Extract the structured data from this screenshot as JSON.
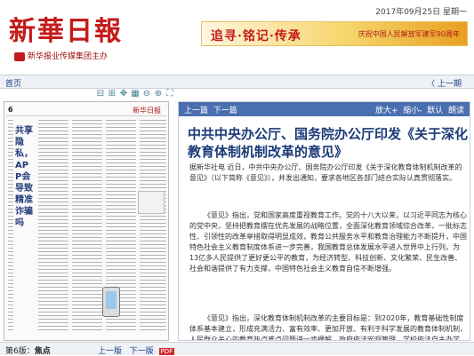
{
  "masthead": {
    "logo": "新華日報",
    "subtitle": "新华报业传媒集团主办",
    "date": "2017年09月25日",
    "weekday": "星期一"
  },
  "banner": {
    "text": "追寻·铭记·传承",
    "subtext": "庆祝中国人民解放军建军90周年"
  },
  "nav": {
    "home": "首页",
    "prev": "〈 上一期"
  },
  "toolbar": {
    "icons": [
      "shrink-icon",
      "expand-icon",
      "move-icon",
      "grid-icon",
      "zoom-out-icon",
      "zoom-in-icon",
      "fullscreen-icon"
    ]
  },
  "thumbnail": {
    "page_no": "6",
    "paper_name": "新华日报",
    "headline": "共享隐私，APP会导致精准诈骗吗"
  },
  "pagenav": {
    "page_label": "第6版：",
    "page_name": "焦点",
    "prev_page": "上一版",
    "next_page": "下一版",
    "pdf": "PDF"
  },
  "article_toolbar": {
    "prev_article": "上一篇",
    "next_article": "下一篇",
    "zoom_in": "放大+",
    "zoom_out": "缩小-",
    "reset": "默认",
    "read": "朗读"
  },
  "article": {
    "title": "中共中央办公厅、国务院办公厅印发《关于深化教育体制机制改革的意见》",
    "p1": "据新华社电 近日，中共中央办公厅、国务院办公厅印发《关于深化教育体制机制改革的意见》（以下简称《意见》），并发出通知，要求各地区各部门结合实际认真贯彻落实。",
    "p2": "《意见》指出，党和国家高度重视教育工作。党的十八大以来，以习近平同志为核心的党中央，坚持把教育摆在优先发展的战略位置，全面深化教育领域综合改革，一批标志性、引领性的改革举措取得明显成效，教育公共服务水平和教育治理能力不断提升，中国特色社会主义教育制度体系进一步完善，我国教育总体发展水平进入世界中上行列，为13亿多人民提供了更好更公平的教育，为经济转型、科技创新、文化繁荣、民生改善、社会和谐提供了有力支撑，中国特色社会主义教育自信不断增强。",
    "p3": "《意见》指出，深化教育体制机制改革的主要目标是：到2020年，教育基础性制度体系基本建立，形成充满活力、富有效率、更加开放、有利于科学发展的教育体制机制，人民群众关心的教育热点难点问题进一步缓解，政府依法宏观管理、学校依法自主办学、社会有序参与、各方合力推进的格局更加完善。"
  }
}
